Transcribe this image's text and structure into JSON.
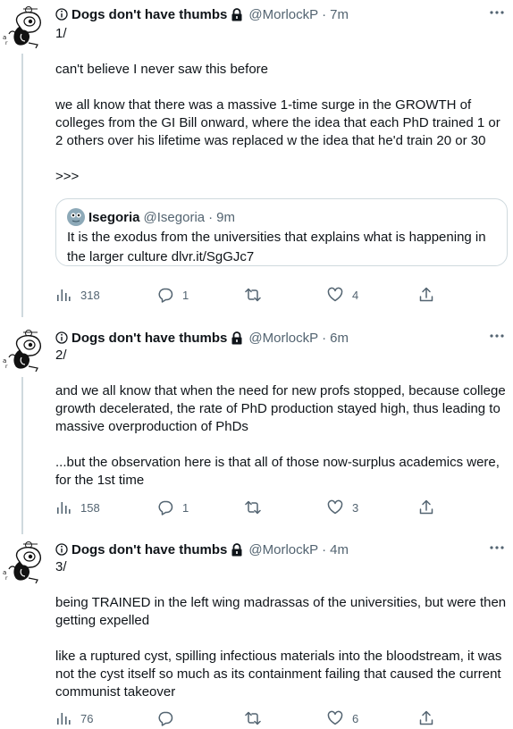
{
  "tweets": [
    {
      "author": "Dogs don't have thumbs",
      "handle": "@MorlockP",
      "separator": "·",
      "time": "7m",
      "body": "1/\n\ncan't believe I never saw this before\n\nwe all know that there was a massive 1-time surge in the GROWTH of colleges from the GI Bill onward, where the idea that each PhD trained 1 or 2 others over his lifetime was replaced w the idea that he'd train 20 or 30\n\n>>>",
      "quote": {
        "author": "Isegoria",
        "handle": "@Isegoria",
        "separator": "·",
        "time": "9m",
        "text": "It is the exodus from the universities that explains what is happening in the larger culture dlvr.it/SgGJc7"
      },
      "views": "318",
      "replies": "1",
      "retweets": "",
      "likes": "4"
    },
    {
      "author": "Dogs don't have thumbs",
      "handle": "@MorlockP",
      "separator": "·",
      "time": "6m",
      "body": "2/\n\nand we all know that when the need for new profs stopped, because college growth decelerated, the rate of PhD production stayed high, thus leading to massive overproduction of PhDs\n\n...but the observation here is that all of those now-surplus academics were, for the 1st time",
      "views": "158",
      "replies": "1",
      "retweets": "",
      "likes": "3"
    },
    {
      "author": "Dogs don't have thumbs",
      "handle": "@MorlockP",
      "separator": "·",
      "time": "4m",
      "body": "3/\n\nbeing TRAINED in the left wing madrassas of the universities, but were then getting expelled\n\nlike a ruptured cyst, spilling infectious materials into the bloodstream, it was not the cyst itself so much as its containment failing that caused the current communist takeover",
      "views": "76",
      "replies": "",
      "retweets": "",
      "likes": "6"
    }
  ],
  "icons": {
    "info": "info-circle-icon",
    "lock": "lock-icon",
    "more": "more-horizontal-icon",
    "views": "views-bar-chart-icon",
    "reply": "reply-bubble-icon",
    "retweet": "retweet-icon",
    "like": "heart-icon",
    "share": "share-arrow-icon"
  },
  "colors": {
    "text": "#0f1419",
    "secondary": "#536471",
    "border": "#cfd9de"
  }
}
